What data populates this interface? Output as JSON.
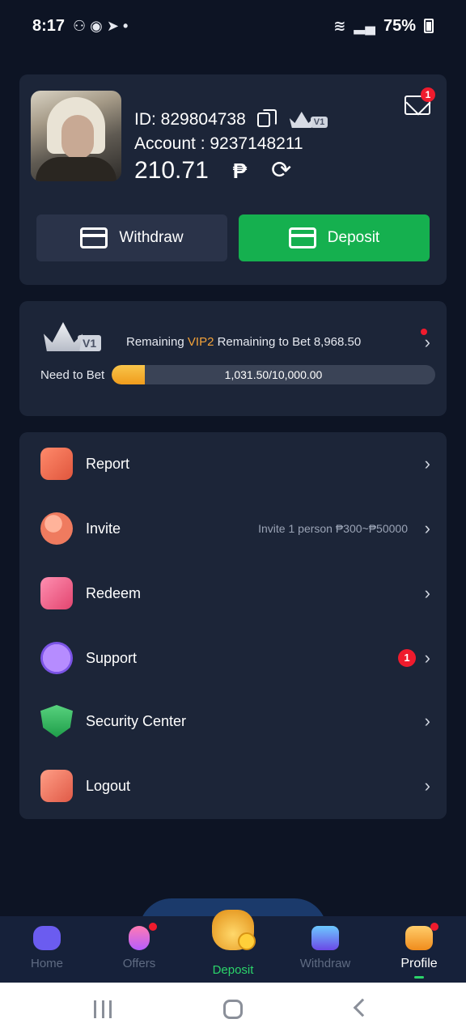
{
  "status_bar": {
    "time": "8:17",
    "battery": "75%",
    "icons": [
      "wifi-icon",
      "signal-icon",
      "call-icon",
      "telegram-icon"
    ]
  },
  "profile": {
    "id_text": "ID: 829804738",
    "vip_level": "V1",
    "account_text": "Account : 9237148211",
    "balance": "210.71",
    "currency": "₱",
    "mail_badge": "1",
    "withdraw_label": "Withdraw",
    "deposit_label": "Deposit"
  },
  "vip": {
    "level": "V1",
    "remaining_prefix": "Remaining",
    "next_level": "VIP2",
    "remaining_suffix": "Remaining to Bet 8,968.50",
    "need_label": "Need to Bet",
    "progress_text": "1,031.50/10,000.00",
    "progress_fraction": 0.10315
  },
  "menu": {
    "items": [
      {
        "label": "Report",
        "icon": "report-icon"
      },
      {
        "label": "Invite",
        "icon": "invite-icon",
        "extra": "Invite 1 person ₱300~₱50000"
      },
      {
        "label": "Redeem",
        "icon": "redeem-icon"
      },
      {
        "label": "Support",
        "icon": "support-icon",
        "badge": "1"
      },
      {
        "label": "Security Center",
        "icon": "security-icon"
      },
      {
        "label": "Logout",
        "icon": "logout-icon"
      }
    ]
  },
  "bottom_nav": {
    "home": "Home",
    "offers": "Offers",
    "deposit": "Deposit",
    "withdraw": "Withdraw",
    "profile": "Profile"
  },
  "colors": {
    "background": "#0d1424",
    "card": "#1c2538",
    "deposit_green": "#15b04f",
    "accent_orange": "#f2a23a",
    "badge_red": "#ef1b2d"
  }
}
